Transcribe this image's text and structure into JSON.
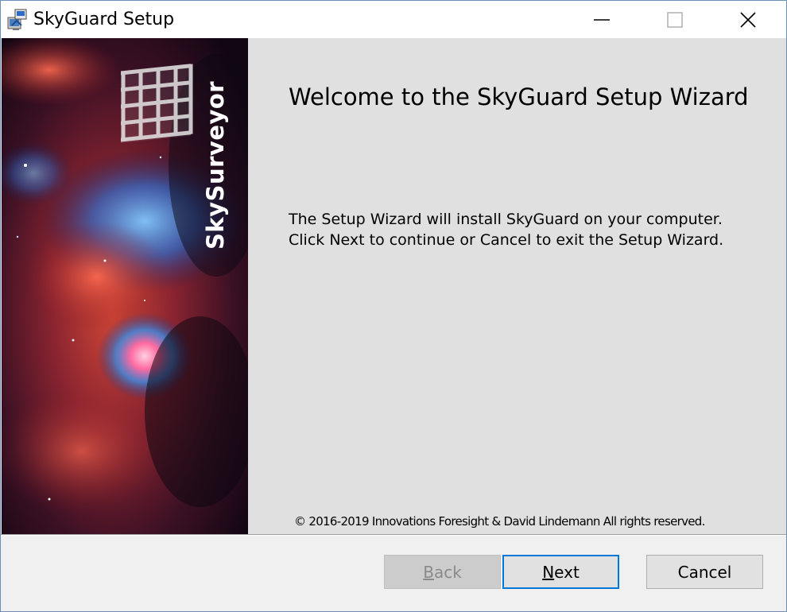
{
  "window": {
    "title": "SkyGuard Setup",
    "controls": {
      "minimize": "minimize-icon",
      "maximize": "maximize-icon",
      "close": "close-icon"
    }
  },
  "banner": {
    "brand": "SkySurveyor"
  },
  "content": {
    "heading": "Welcome to the SkyGuard Setup Wizard",
    "description_lines": [
      "The Setup Wizard will install SkyGuard on your computer.",
      "Click Next to continue or Cancel to exit the Setup Wizard."
    ],
    "copyright": "© 2016-2019 Innovations Foresight & David Lindemann All rights reserved."
  },
  "buttons": {
    "back": {
      "accel": "B",
      "rest": "ack",
      "enabled": false
    },
    "next": {
      "accel": "N",
      "rest": "ext",
      "enabled": true
    },
    "cancel": {
      "label": "Cancel",
      "enabled": true
    }
  },
  "colors": {
    "content_bg": "#e0e0e0",
    "button_focus": "#0078d7",
    "disabled_text": "#8a8a8a"
  }
}
